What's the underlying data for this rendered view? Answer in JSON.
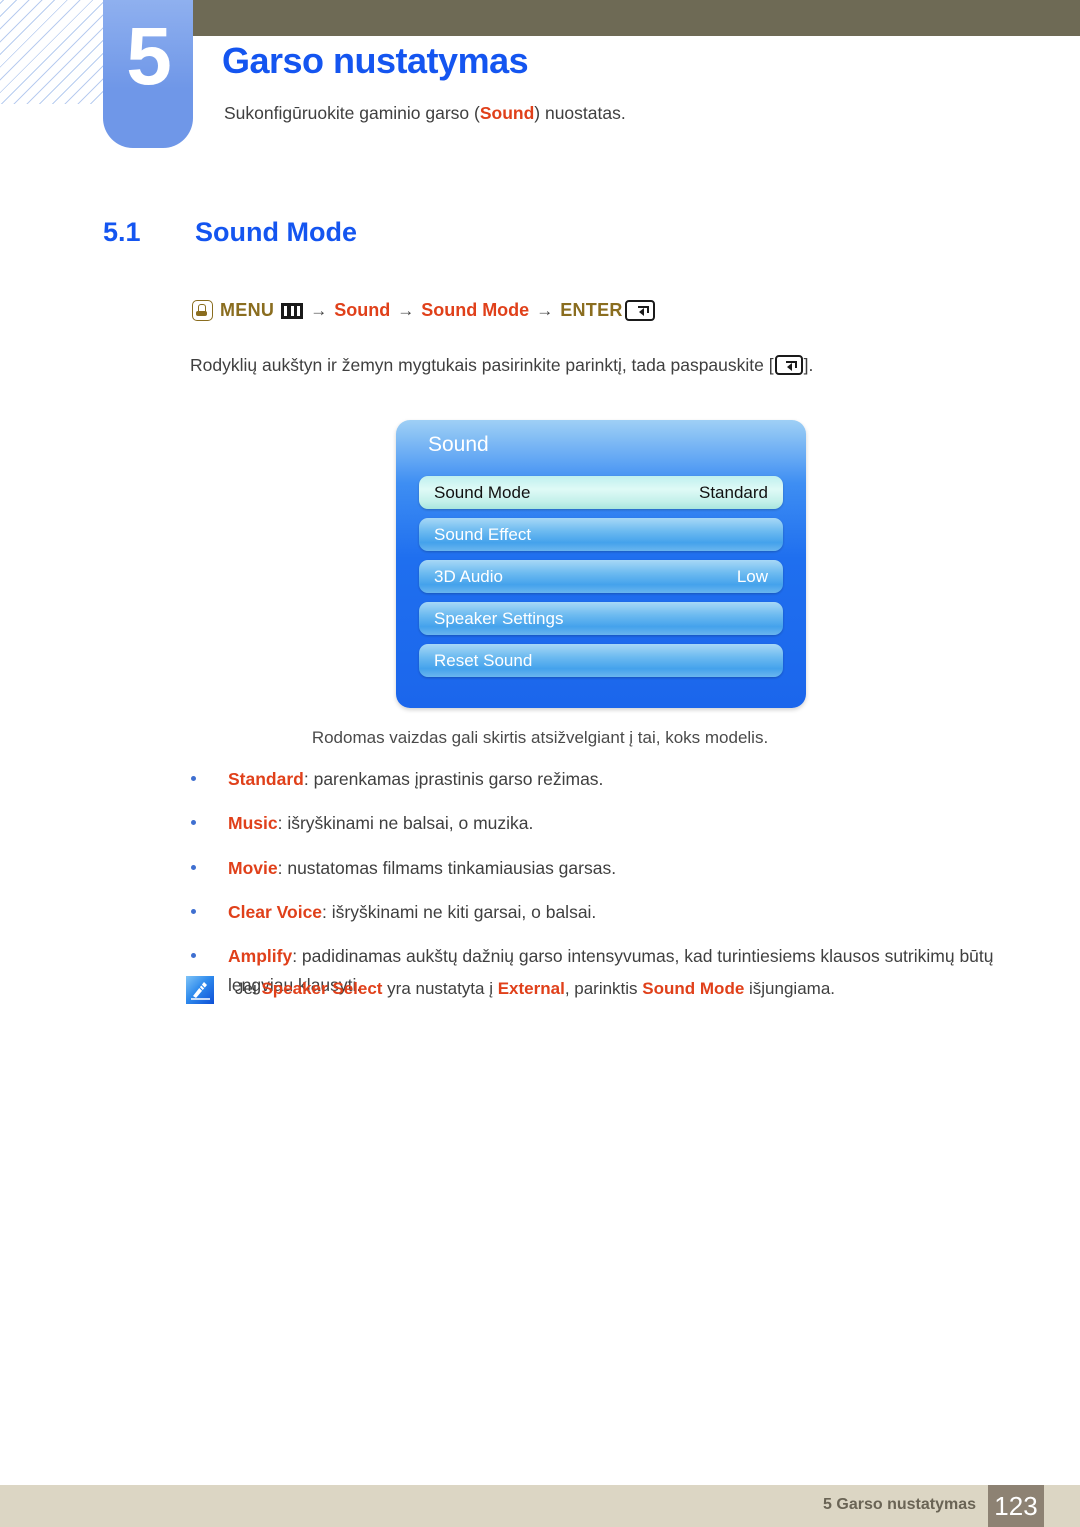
{
  "chapter": {
    "number": "5",
    "title": "Garso nustatymas",
    "subtitle_prefix": "Sukonfigūruokite gaminio garso (",
    "subtitle_highlight": "Sound",
    "subtitle_suffix": ") nuostatas."
  },
  "section": {
    "number": "5.1",
    "name": "Sound Mode"
  },
  "menu_path": {
    "hand_icon": "hand-press-icon",
    "menu_label": "MENU",
    "menu_icon": "menu-grid-icon",
    "arrow": "→",
    "item1": "Sound",
    "item2": "Sound Mode",
    "enter_label": "ENTER",
    "enter_icon": "enter-key-icon"
  },
  "instruction": {
    "before": "Rodyklių aukštyn ir žemyn mygtukais pasirinkite parinktį, tada paspauskite [",
    "after": "]."
  },
  "osd": {
    "title": "Sound",
    "rows": [
      {
        "label": "Sound Mode",
        "value": "Standard",
        "selected": true
      },
      {
        "label": "Sound Effect",
        "value": "",
        "selected": false
      },
      {
        "label": "3D Audio",
        "value": "Low",
        "selected": false
      },
      {
        "label": "Speaker Settings",
        "value": "",
        "selected": false
      },
      {
        "label": "Reset Sound",
        "value": "",
        "selected": false
      }
    ],
    "caption": "Rodomas vaizdas gali skirtis atsižvelgiant į tai, koks modelis."
  },
  "bullets": [
    {
      "term": "Standard",
      "text": ": parenkamas įprastinis garso režimas."
    },
    {
      "term": "Music",
      "text": ": išryškinami ne balsai, o muzika."
    },
    {
      "term": "Movie",
      "text": ": nustatomas filmams tinkamiausias garsas."
    },
    {
      "term": "Clear Voice",
      "text": ": išryškinami ne kiti garsai, o balsai."
    },
    {
      "term": "Amplify",
      "text": ": padidinamas aukštų dažnių garso intensyvumas, kad turintiesiems klausos sutrikimų būtų lengviau klausyti."
    }
  ],
  "note": {
    "icon": "note-pen-icon",
    "part1": "Jei ",
    "term1": "Speaker Select",
    "part2": " yra nustatyta į ",
    "term2": "External",
    "part3": ", parinktis ",
    "term3": "Sound Mode",
    "part4": " išjungiama."
  },
  "footer": {
    "text": "5 Garso nustatymas",
    "page": "123"
  },
  "colors": {
    "accent_blue": "#1455f0",
    "term_orange": "#e0401a",
    "gold": "#8a6d1f",
    "header_olive": "#6e6a55",
    "footer_beige": "#dcd6c4",
    "footer_page_box": "#8d8273"
  }
}
